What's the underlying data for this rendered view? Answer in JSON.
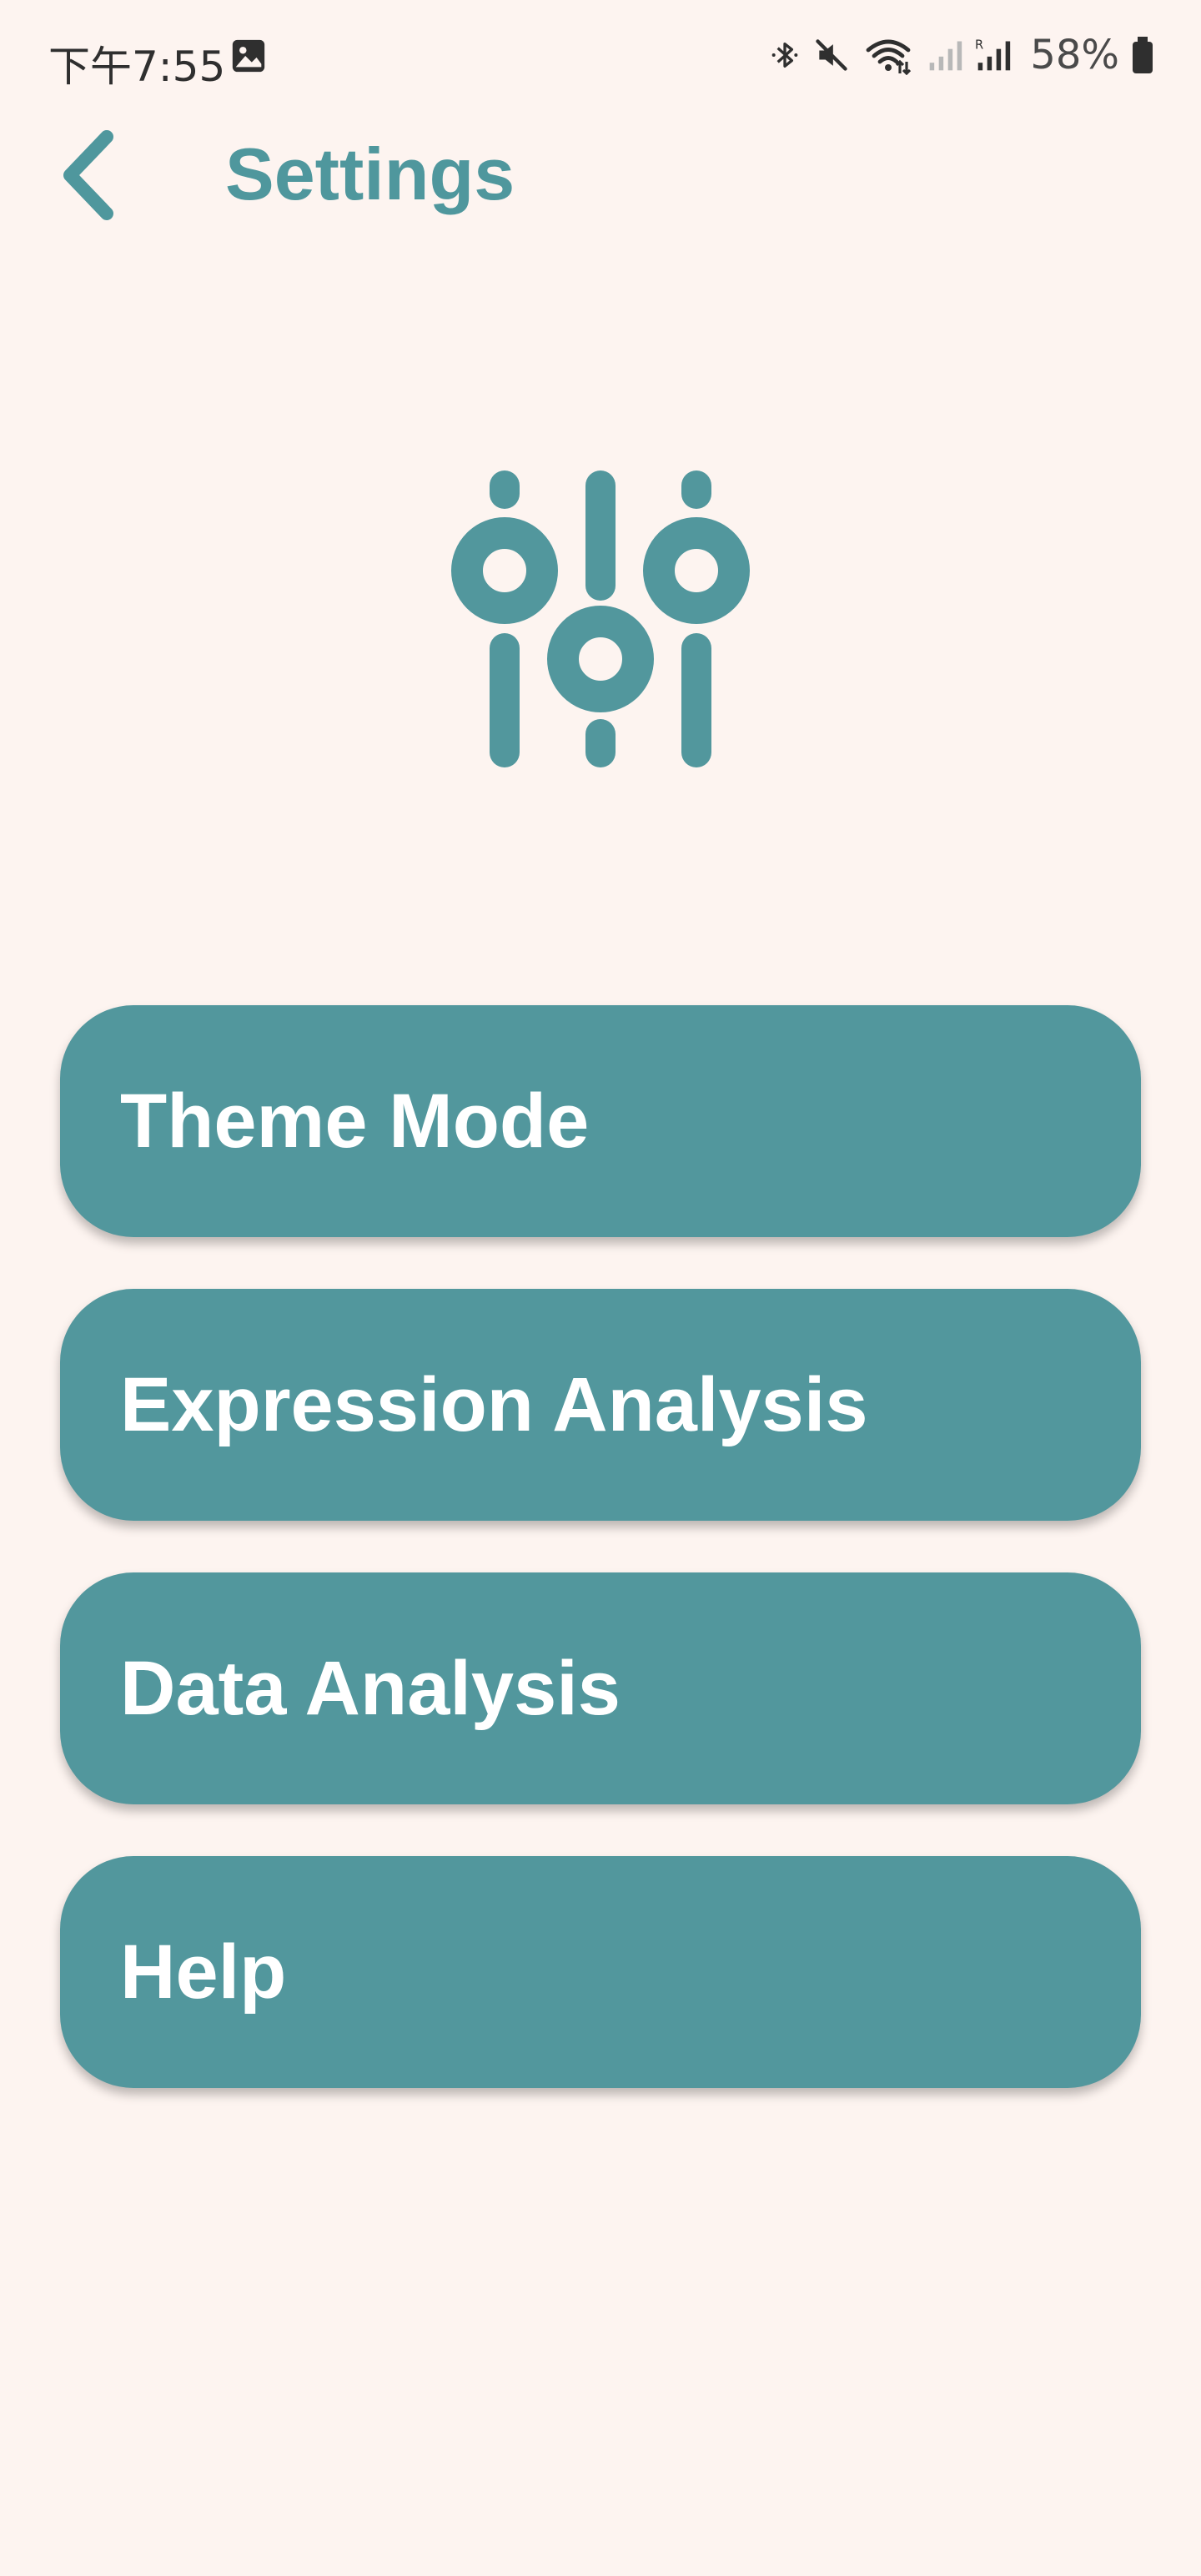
{
  "status_bar": {
    "time": "下午7:55",
    "battery": "58%",
    "icons": [
      "image-icon",
      "bluetooth-icon",
      "mute-icon",
      "wifi-icon",
      "signal-icon",
      "roaming-signal-icon",
      "battery-icon"
    ]
  },
  "header": {
    "title": "Settings",
    "back_icon": "chevron-left-icon"
  },
  "hero": {
    "icon": "sliders-icon"
  },
  "menu": {
    "items": [
      {
        "label": "Theme Mode"
      },
      {
        "label": "Expression Analysis"
      },
      {
        "label": "Data Analysis"
      },
      {
        "label": "Help"
      }
    ]
  },
  "colors": {
    "background": "#fdf4f0",
    "accent": "#52979d",
    "button_text": "#ffffff"
  }
}
